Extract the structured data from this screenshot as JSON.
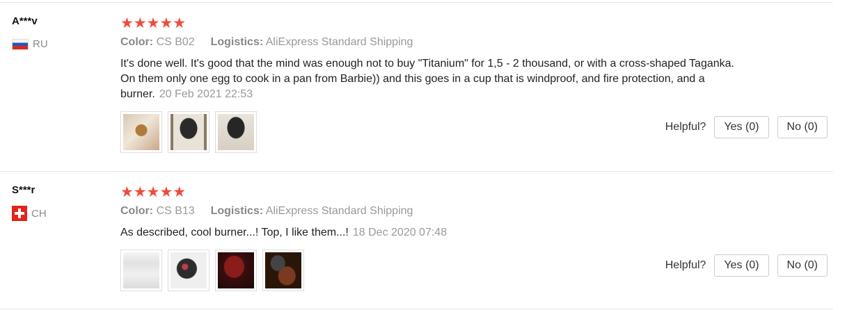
{
  "reviews": [
    {
      "user": "A***v",
      "country": "RU",
      "stars": "★★★★★",
      "color_label": "Color:",
      "color_value": "CS B02",
      "logistics_label": "Logistics:",
      "logistics_value": "AliExpress Standard Shipping",
      "text": "It's done well. It's good that the mind was enough not to buy \"Titanium\" for 1,5 - 2 thousand, or with a cross-shaped Taganka. On them only one egg to cook in a pan from Barbie)) and this goes in a cup that is windproof, and fire protection, and a burner.",
      "date": "20 Feb 2021 22:53",
      "helpful_label": "Helpful?",
      "yes_label": "Yes (0)",
      "no_label": "No (0)"
    },
    {
      "user": "S***r",
      "country": "CH",
      "stars": "★★★★★",
      "color_label": "Color:",
      "color_value": "CS B13",
      "logistics_label": "Logistics:",
      "logistics_value": "AliExpress Standard Shipping",
      "text": "As described, cool burner...! Top, I like them...!",
      "date": "18 Dec 2020 07:48",
      "helpful_label": "Helpful?",
      "yes_label": "Yes (0)",
      "no_label": "No (0)"
    }
  ],
  "colors": {
    "star": "#f04b3b",
    "muted": "#999999"
  }
}
